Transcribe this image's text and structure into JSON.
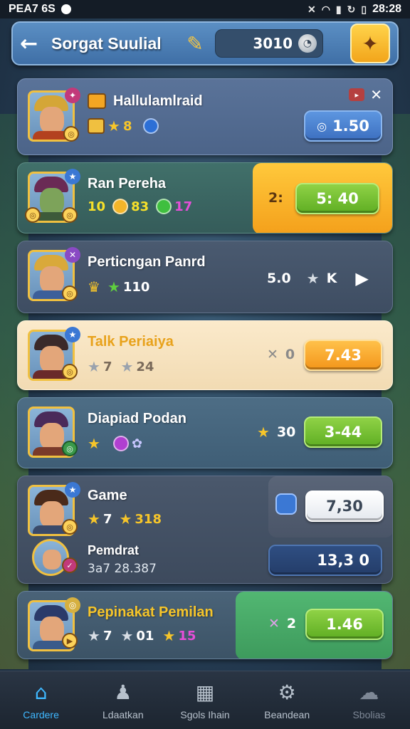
{
  "status_bar": {
    "carrier": "PEA7 6S",
    "time": "28:28"
  },
  "header": {
    "title": "Sorgat Suulial",
    "currency_value": "3010",
    "colors": {
      "accent": "#3f6fa6",
      "shop": "#f2a51b"
    }
  },
  "cards": [
    {
      "name": "Hallulamlraid",
      "stat_star": "8",
      "button": "1.50"
    },
    {
      "name": "Ran Pereha",
      "stats": [
        "10",
        "83",
        "17"
      ],
      "side_label": "2:",
      "button": "5: 40"
    },
    {
      "name": "Perticngan Panrd",
      "stats": [
        "110"
      ],
      "meta_value": "5.0",
      "meta_k": "K"
    },
    {
      "name": "Talk Periaiya",
      "stats": [
        "7",
        "24"
      ],
      "meta_value": "0",
      "button": "7.43"
    },
    {
      "name": "Diapiad Podan",
      "meta_value": "30",
      "button": "3-44"
    },
    {
      "name": "Game",
      "stats": [
        "7",
        "318"
      ],
      "sub_name": "Pemdrat",
      "sub_stats": "3a7 28.387",
      "button_top": "7,30",
      "button_bottom": "13,3 0"
    },
    {
      "name": "Pepinakat Pemilan",
      "stats": [
        "7",
        "01",
        "15"
      ],
      "meta_value": "2",
      "button": "1.46"
    }
  ],
  "nav": [
    {
      "label": "Cardere",
      "icon": "home-icon"
    },
    {
      "label": "Ldaatkan",
      "icon": "profile-icon"
    },
    {
      "label": "Sgols Ihain",
      "icon": "cards-icon"
    },
    {
      "label": "Beandean",
      "icon": "settings-icon"
    },
    {
      "label": "Sbolias",
      "icon": "ghost-icon"
    }
  ]
}
